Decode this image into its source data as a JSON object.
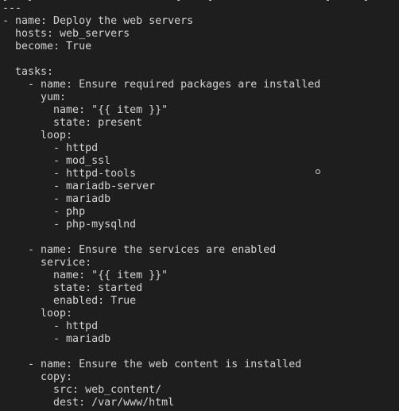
{
  "top_cutoff_text": "[   [                       ]    [                  ]     [            ]   ]",
  "lines": [
    "---",
    "- name: Deploy the web servers",
    "  hosts: web_servers",
    "  become: True",
    "",
    "  tasks:",
    "    - name: Ensure required packages are installed",
    "      yum:",
    "        name: \"{{ item }}\"",
    "        state: present",
    "      loop:",
    "        - httpd",
    "        - mod_ssl",
    "        - httpd-tools",
    "        - mariadb-server",
    "        - mariadb",
    "        - php",
    "        - php-mysqlnd",
    "",
    "    - name: Ensure the services are enabled",
    "      service:",
    "        name: \"{{ item }}\"",
    "        state: started",
    "        enabled: True",
    "      loop:",
    "        - httpd",
    "        - mariadb",
    "",
    "    - name: Ensure the web content is installed",
    "      copy:",
    "        src: web_content/",
    "        dest: /var/www/html"
  ]
}
